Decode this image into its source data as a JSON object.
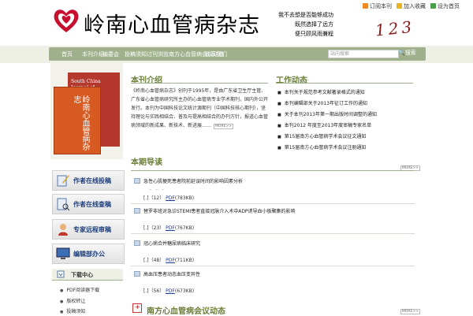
{
  "header": {
    "logo_text": "岭南心血管病杂志",
    "poem": [
      "我不去想是否能够成功",
      "既然选择了远方",
      "便只顾风雨兼程"
    ],
    "toplinks": [
      "订阅本刊",
      "加入收藏",
      "设为首页"
    ],
    "issue_digits": "123"
  },
  "nav": {
    "items": [
      "首页",
      "本刊介绍",
      "编委会",
      "投稿须知",
      "过刊浏览",
      "南方心血管病会议动态",
      "联系我们"
    ],
    "search_placeholder": "站内搜索",
    "search_button": "搜索"
  },
  "covers": {
    "back_title": "South China Journal of Cardiology",
    "front_title": "岭南心血管病杂志"
  },
  "sidebar": {
    "buttons": [
      "作者在线投稿",
      "作者在线查稿",
      "专家远程审稿",
      "编辑部办公"
    ],
    "download_title": "下载中心",
    "download_items": [
      "PDF阅读器下载",
      "版权转让",
      "投稿须知"
    ]
  },
  "intro": {
    "title": "本刊介绍",
    "body": "《岭南心血管病杂志》创刊于1995年，是由广东省卫生厅主管、广东省心血管病研究所主办的心血管病专业学术期刊，国内外公开发行。本刊为中国科技论文统计源期刊（中国科技核心期刊），坚持理论与实践相结合、普及与提高相结合的办刊方针，报道心血管病领域的新成果、新技术、新进展……",
    "more": "MORE>>"
  },
  "news": {
    "title": "工作动态",
    "items": [
      "本刊关于规范参考文献著录格式的通知",
      "本刊编辑部关于2013年征订工作的通知",
      "关于本刊2013年第一期出版时间调整的通知",
      "本刊2012 年度至2013年度审稿专家名单",
      "第15届南方心血管病学术会议征文通知",
      "第15届南方心血管病学术会议注册通知"
    ]
  },
  "toc": {
    "title": "本期导读",
    "more": "MORE>>",
    "articles": [
      {
        "title": "急性心肌梗死患者院前延误时间的影响因素分析",
        "ellipsis": ". . .",
        "meta_pre": "[",
        "pages": "12",
        "pdf": "PDF",
        "size": "(783KB)"
      },
      {
        "title": "替罗非班对急诊STEMI患者直接冠脉介入术中ADP诱导血小板聚集的影响",
        "ellipsis": "",
        "meta_pre": "[",
        "pages": "23",
        "pdf": "PDF",
        "size": "(767KB)"
      },
      {
        "title": "冠心病合并糖尿病临床研究",
        "ellipsis": "",
        "meta_pre": "[",
        "pages": "48",
        "pdf": "PDF",
        "size": "(711KB)"
      },
      {
        "title": "高血压患者动态血压变异性",
        "ellipsis": "",
        "meta_pre": "[",
        "pages": "56",
        "pdf": "PDF",
        "size": "(673KB)"
      }
    ]
  },
  "conference": {
    "title": "南方心血管病会议动态",
    "more": "MORE>>"
  },
  "colors": {
    "accent": "#6b7f3a",
    "nav": "#9fb08c",
    "link": "#1a3a9a"
  }
}
